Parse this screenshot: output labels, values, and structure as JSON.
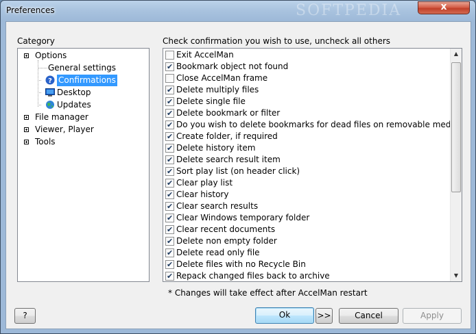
{
  "window": {
    "title": "Preferences",
    "watermark": "SOFTPEDIA",
    "close_glyph": "x"
  },
  "category": {
    "label": "Category",
    "items": [
      {
        "label": "Options",
        "expander": true,
        "icon": ""
      },
      {
        "label": "General settings",
        "expander": false,
        "icon": ""
      },
      {
        "label": "Confirmations",
        "expander": false,
        "icon": "help-icon",
        "selected": true
      },
      {
        "label": "Desktop",
        "expander": false,
        "icon": "desktop-icon"
      },
      {
        "label": "Updates",
        "expander": false,
        "icon": "globe-icon"
      },
      {
        "label": "File manager",
        "expander": true,
        "icon": ""
      },
      {
        "label": "Viewer, Player",
        "expander": true,
        "icon": ""
      },
      {
        "label": "Tools",
        "expander": true,
        "icon": ""
      }
    ]
  },
  "confirmations": {
    "label": "Check confirmation you wish to use, uncheck all others",
    "items": [
      {
        "label": "Exit AccelMan",
        "checked": false
      },
      {
        "label": "Bookmark object not found",
        "checked": true
      },
      {
        "label": "Close AccelMan frame",
        "checked": false
      },
      {
        "label": "Delete multiply files",
        "checked": true
      },
      {
        "label": "Delete single file",
        "checked": true
      },
      {
        "label": "Delete bookmark or filter",
        "checked": true
      },
      {
        "label": "Do you wish to delete bookmarks for dead files on removable media too?",
        "checked": true
      },
      {
        "label": "Create folder, if required",
        "checked": true
      },
      {
        "label": "Delete history item",
        "checked": true
      },
      {
        "label": "Delete search result item",
        "checked": true
      },
      {
        "label": "Sort play list (on header click)",
        "checked": true
      },
      {
        "label": "Clear play list",
        "checked": true
      },
      {
        "label": "Clear history",
        "checked": true
      },
      {
        "label": "Clear search results",
        "checked": true
      },
      {
        "label": "Clear Windows temporary folder",
        "checked": true
      },
      {
        "label": "Clear recent documents",
        "checked": true
      },
      {
        "label": "Delete non empty folder",
        "checked": true
      },
      {
        "label": "Delete read only file",
        "checked": true
      },
      {
        "label": "Delete files with no Recycle Bin",
        "checked": true
      },
      {
        "label": "Repack changed files back to archive",
        "checked": true
      }
    ]
  },
  "note": "* Changes will take effect after AccelMan restart",
  "buttons": {
    "help": "?",
    "ok": "Ok",
    "more": ">>",
    "cancel": "Cancel",
    "apply": "Apply"
  }
}
